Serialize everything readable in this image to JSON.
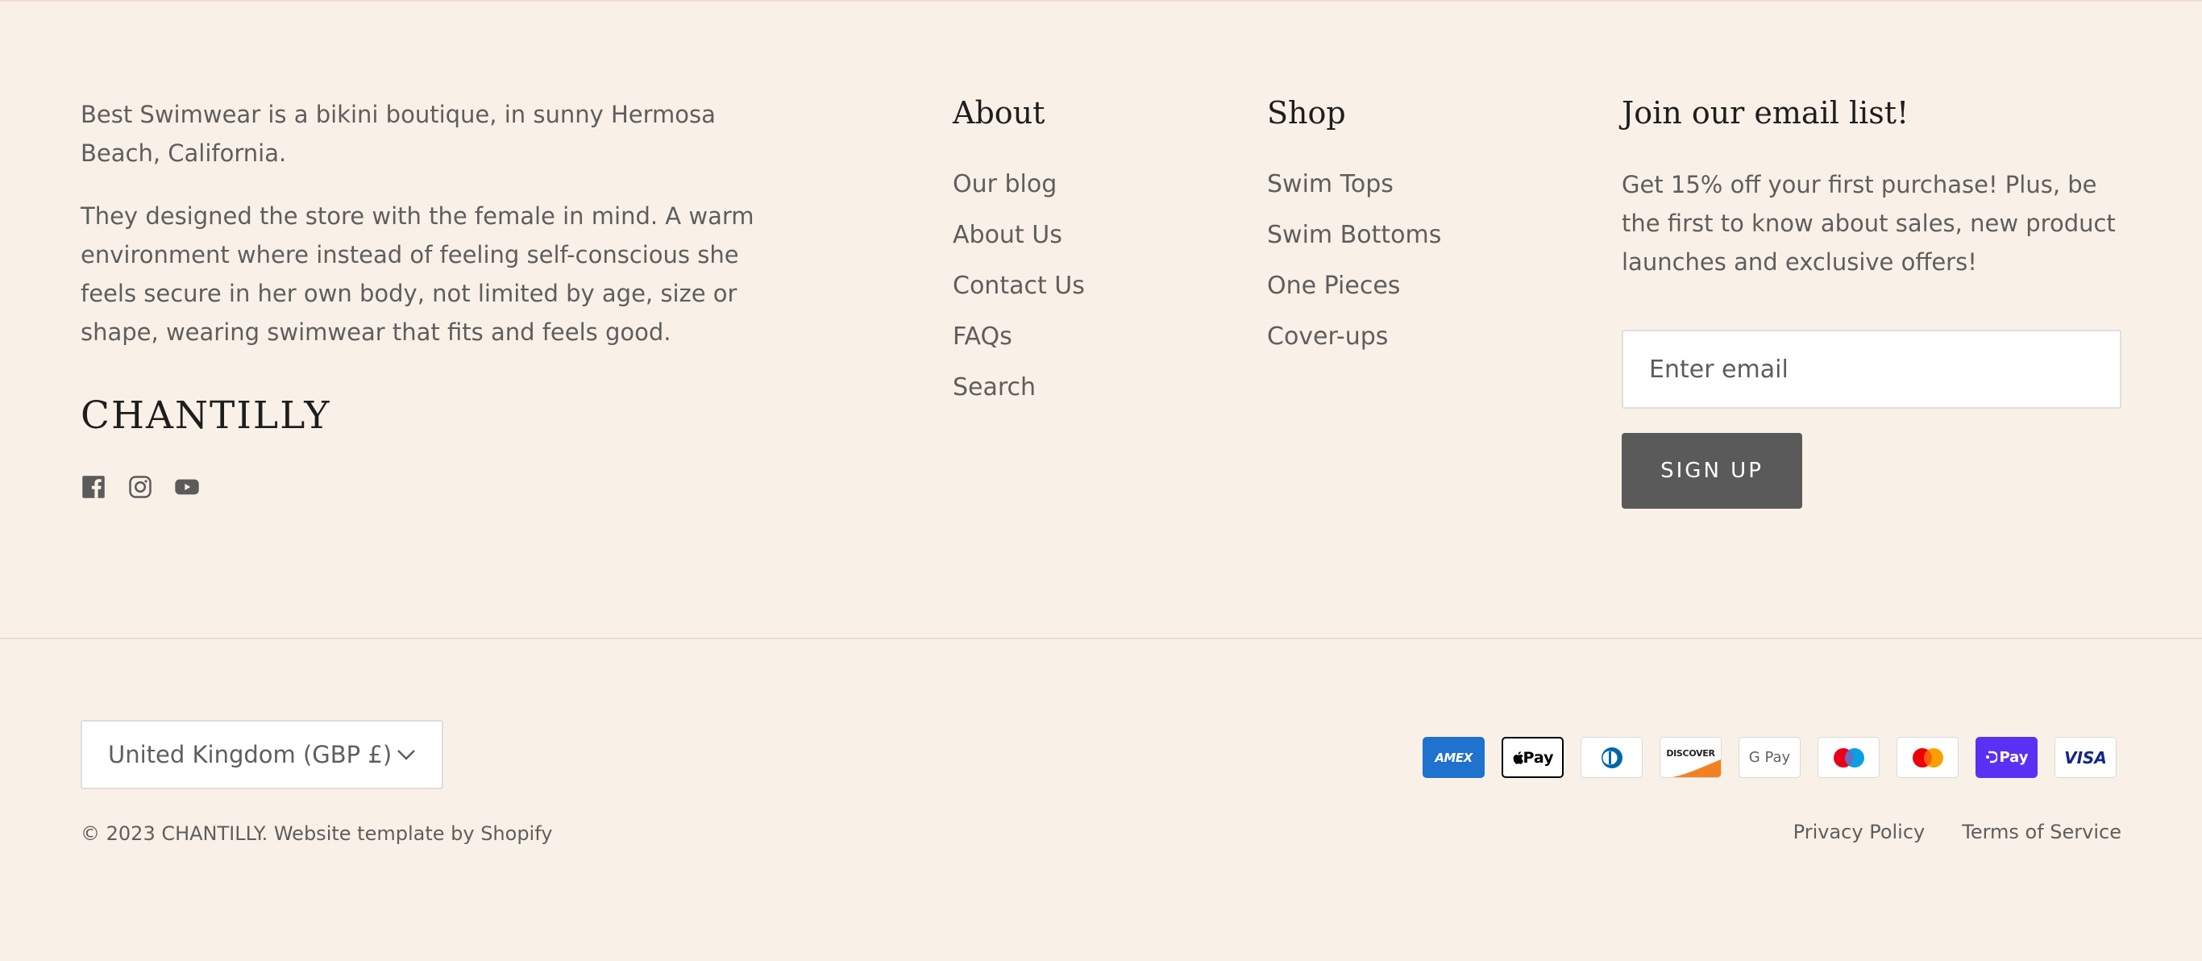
{
  "about": {
    "paragraph_1": "Best Swimwear is a bikini boutique, in sunny Hermosa Beach, California.",
    "paragraph_2": "They designed the store with the female in mind. A warm environment where instead of feeling self-conscious she feels secure in her own body, not limited by age, size or shape, wearing swimwear that fits and feels good.",
    "brand": "CHANTILLY",
    "social_icons": [
      "facebook-icon",
      "instagram-icon",
      "youtube-icon"
    ]
  },
  "about_nav": {
    "heading": "About",
    "items": [
      "Our blog",
      "About Us",
      "Contact Us",
      "FAQs",
      "Search"
    ]
  },
  "shop_nav": {
    "heading": "Shop",
    "items": [
      "Swim Tops",
      "Swim Bottoms",
      "One Pieces",
      "Cover-ups"
    ]
  },
  "newsletter": {
    "heading": "Join our email list!",
    "text": "Get 15% off your first purchase! Plus, be the first to know about sales, new product launches and exclusive offers!",
    "email_placeholder": "Enter email",
    "button_label": "SIGN UP"
  },
  "bottom": {
    "country_selected": "United Kingdom (GBP £)",
    "copyright": "© 2023 CHANTILLY. Website template by Shopify",
    "legal_links": [
      "Privacy Policy",
      "Terms of Service"
    ]
  },
  "payments": [
    {
      "name": "amex-icon",
      "label": "AMEX",
      "bg": "#1f72cd",
      "fg": "#ffffff"
    },
    {
      "name": "apple-pay-icon",
      "label": " Pay",
      "bg": "#ffffff",
      "fg": "#000000"
    },
    {
      "name": "diners-club-icon",
      "label": "",
      "bg": "#ffffff",
      "fg": "#0165ac"
    },
    {
      "name": "discover-icon",
      "label": "DISCOVER",
      "bg": "#ffffff",
      "fg": "#231f20"
    },
    {
      "name": "google-pay-icon",
      "label": "G Pay",
      "bg": "#ffffff",
      "fg": "#5f6368"
    },
    {
      "name": "maestro-icon",
      "label": "",
      "bg": "#ffffff",
      "fg": "#000000"
    },
    {
      "name": "mastercard-icon",
      "label": "",
      "bg": "#ffffff",
      "fg": "#000000"
    },
    {
      "name": "shop-pay-icon",
      "label": "Pay",
      "bg": "#5a31f4",
      "fg": "#ffffff"
    },
    {
      "name": "visa-icon",
      "label": "VISA",
      "bg": "#ffffff",
      "fg": "#142688"
    }
  ],
  "colors": {
    "background": "#f9f1e7",
    "text": "#5e5e5e",
    "heading": "#1e1e1e",
    "button": "#5a5a5a"
  }
}
